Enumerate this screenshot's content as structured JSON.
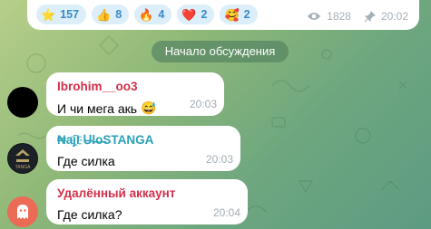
{
  "post": {
    "reactions": [
      {
        "emoji": "⭐",
        "count": "157"
      },
      {
        "emoji": "👍",
        "count": "8"
      },
      {
        "emoji": "🔥",
        "count": "4"
      },
      {
        "emoji": "❤️",
        "count": "2"
      },
      {
        "emoji": "🥰",
        "count": "2"
      }
    ],
    "views": "1828",
    "time": "20:02"
  },
  "discussion_chip": "Начало обсуждения",
  "messages": [
    {
      "sender": "Ibrohim__oo3",
      "sender_color": "#d32f4a",
      "text": "И чи мега акь",
      "emoji": "😅",
      "time": "20:03",
      "avatar": "black-circle"
    },
    {
      "sender": "₦aj҈I ᑌ̶l̶o̶STANGA",
      "sender_color": "#2aa0b8",
      "text": "Где силка",
      "time": "20:03",
      "avatar": "tanga-logo"
    },
    {
      "sender": "Удалённый аккаунт",
      "sender_color": "#d32f4a",
      "text": "Где силка?",
      "time": "20:04",
      "avatar": "deleted-ghost"
    }
  ],
  "colors": {
    "accent": "#3a8ac4",
    "reaction_bg": "#dbeef9"
  }
}
